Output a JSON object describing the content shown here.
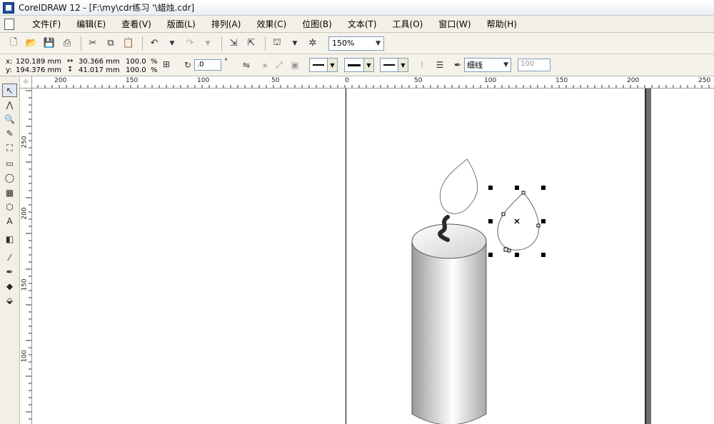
{
  "window": {
    "title": "CorelDRAW 12 - [F:\\my\\cdr练习  '\\蜡烛.cdr]"
  },
  "menu": [
    {
      "label": "文件(F)"
    },
    {
      "label": "编辑(E)"
    },
    {
      "label": "查看(V)"
    },
    {
      "label": "版面(L)"
    },
    {
      "label": "排列(A)"
    },
    {
      "label": "效果(C)"
    },
    {
      "label": "位图(B)"
    },
    {
      "label": "文本(T)"
    },
    {
      "label": "工具(O)"
    },
    {
      "label": "窗口(W)"
    },
    {
      "label": "帮助(H)"
    }
  ],
  "toolbar": {
    "zoom": "150%"
  },
  "propbar": {
    "x_label": "x:",
    "x_value": "120.189 mm",
    "y_label": "y:",
    "y_value": "194.376 mm",
    "w_value": "30.366 mm",
    "h_value": "41.017 mm",
    "scale_w": "100.0",
    "scale_h": "100.0",
    "pct": "%",
    "rotation": ".0",
    "outline": "细线",
    "opacity": "100"
  },
  "ruler": {
    "top_labels": [
      "200",
      "150",
      "100",
      "50",
      "0",
      "50",
      "100",
      "150",
      "200",
      "250"
    ],
    "left_labels": [
      "250",
      "200",
      "150",
      "100"
    ],
    "corner": "⊹"
  },
  "colors": {
    "candle_light": "#ffffff",
    "candle_dark": "#9a9a9a",
    "wick": "#2a2a2a"
  }
}
